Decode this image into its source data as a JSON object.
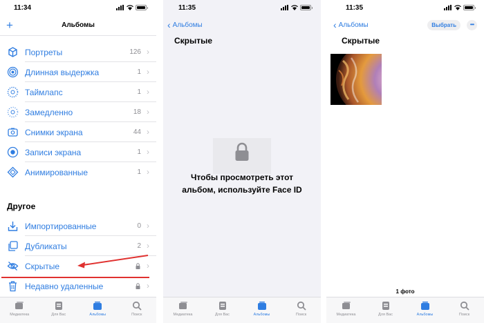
{
  "colors": {
    "accent": "#2f7de1",
    "annotation": "#e0312f",
    "secondary_text": "#8e8e93"
  },
  "screen1": {
    "time": "11:34",
    "nav_title": "Альбомы",
    "add_icon": "plus-icon",
    "rows": [
      {
        "label": "Портреты",
        "count": "126",
        "icon": "portrait-cube-icon"
      },
      {
        "label": "Длинная выдержка",
        "count": "1",
        "icon": "long-exposure-icon"
      },
      {
        "label": "Таймлапс",
        "count": "1",
        "icon": "timelapse-icon"
      },
      {
        "label": "Замедленно",
        "count": "18",
        "icon": "slow-motion-icon"
      },
      {
        "label": "Снимки экрана",
        "count": "44",
        "icon": "screenshot-icon"
      },
      {
        "label": "Записи экрана",
        "count": "1",
        "icon": "screen-recording-icon"
      },
      {
        "label": "Анимированные",
        "count": "1",
        "icon": "animated-icon"
      }
    ],
    "section_header": "Другое",
    "other_rows": [
      {
        "label": "Импортированные",
        "count": "0",
        "icon": "import-icon"
      },
      {
        "label": "Дубликаты",
        "count": "2",
        "icon": "duplicates-icon"
      },
      {
        "label": "Скрытые",
        "count": "",
        "icon": "eye-slash-icon",
        "locked": true
      },
      {
        "label": "Недавно удаленные",
        "count": "",
        "icon": "trash-icon",
        "locked": true
      }
    ]
  },
  "screen2": {
    "time": "11:35",
    "back_label": "Альбомы",
    "title": "Скрытые",
    "lock_message_line1": "Чтобы просмотреть этот",
    "lock_message_line2": "альбом, используйте Face ID"
  },
  "screen3": {
    "time": "11:35",
    "back_label": "Альбомы",
    "title": "Скрытые",
    "select_label": "Выбрать",
    "more_label": "•••",
    "photo_count": "1 фото"
  },
  "tabbar": {
    "tabs": [
      {
        "label": "Медиатека",
        "icon": "photos-library-icon",
        "active": false
      },
      {
        "label": "Для Вас",
        "icon": "for-you-icon",
        "active": false
      },
      {
        "label": "Альбомы",
        "icon": "albums-icon",
        "active": true
      },
      {
        "label": "Поиск",
        "icon": "search-icon",
        "active": false
      }
    ]
  }
}
